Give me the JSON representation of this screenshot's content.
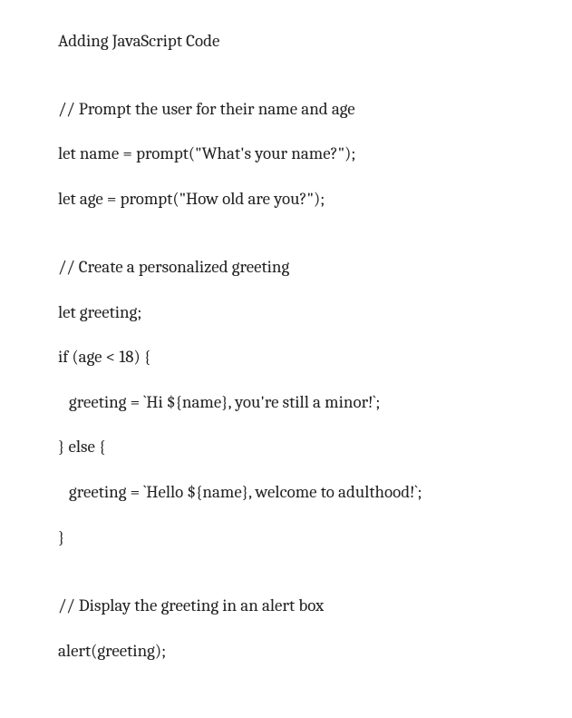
{
  "title": "Adding JavaScript Code",
  "code": {
    "l01": "// Prompt the user for their name and age",
    "l02": "let name = prompt(\"What's your name?\");",
    "l03": "let age = prompt(\"How old are you?\");",
    "l04": "// Create a personalized greeting",
    "l05": "let greeting;",
    "l06": "if (age < 18) {",
    "l07": "greeting = `Hi ${name}, you're still a minor!`;",
    "l08": "} else {",
    "l09": "greeting = `Hello ${name}, welcome to adulthood!`;",
    "l10": "}",
    "l11": "// Display the greeting in an alert box",
    "l12": "alert(greeting);"
  }
}
